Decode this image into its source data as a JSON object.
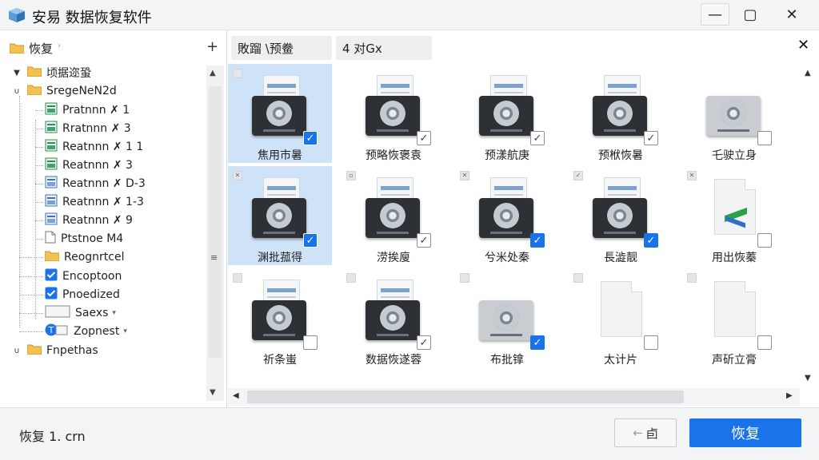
{
  "window": {
    "title": "安易  数据恢复软件",
    "controls": {
      "minimize": "—",
      "maximize": "▢",
      "close": "✕"
    }
  },
  "left_panel": {
    "header": {
      "label": "恢复",
      "chevron": "›",
      "add": "+"
    },
    "tree": [
      {
        "id": "root",
        "label": "顷据迩蛩",
        "twist": "▼",
        "icon": "folder-icon",
        "expanded": true
      },
      {
        "id": "storage",
        "label": "SregeNeN2d",
        "twist": "∪",
        "icon": "folder-icon",
        "expanded": true
      },
      {
        "id": "p1",
        "label": "Pratnnn ✗ 1",
        "icon": "partition-icon"
      },
      {
        "id": "p2",
        "label": "Rratnnn ✗ 3",
        "icon": "partition-icon"
      },
      {
        "id": "p3",
        "label": "Reatnnn ✗ 1 1",
        "icon": "partition-icon"
      },
      {
        "id": "p4",
        "label": "Reatnnn ✗ 3",
        "icon": "partition-icon"
      },
      {
        "id": "p5",
        "label": "Reatnnn ✗ D-3",
        "icon": "partition-icon"
      },
      {
        "id": "p6",
        "label": "Reatnnn ✗ 1-3",
        "icon": "partition-icon"
      },
      {
        "id": "p7",
        "label": "Reatnnn ✗ 9",
        "icon": "partition-icon"
      },
      {
        "id": "p8",
        "label": "Ptstnoe M4",
        "icon": "document-icon"
      },
      {
        "id": "recognized",
        "label": "Reognrtcel",
        "icon": "folder-icon"
      },
      {
        "id": "encrypted",
        "label": "Encoptoon",
        "icon": "checkbox-icon",
        "checked": true
      },
      {
        "id": "protected",
        "label": "Pnoedized",
        "icon": "checkbox-icon",
        "checked": true
      },
      {
        "id": "saved",
        "label": "Saexs",
        "icon": "file-icon",
        "dropdown": "▾"
      },
      {
        "id": "support",
        "label": "Zopnest",
        "icon": "info-icon",
        "dropdown": "▾"
      },
      {
        "id": "properties",
        "label": "Fnpethas",
        "twist": "∪",
        "icon": "folder-icon"
      }
    ],
    "scroll": {
      "up": "▲",
      "down": "▼",
      "grip": "≡"
    }
  },
  "tabs": [
    {
      "label": "敗蹓 \\预鲞"
    },
    {
      "label": "4 对Gx"
    }
  ],
  "tab_close": "✕",
  "grid": {
    "items": [
      {
        "label": "焦用市暑",
        "kind": "drive",
        "checked": true,
        "selected": true
      },
      {
        "label": "预略恢褒袁",
        "kind": "drive",
        "checked": true
      },
      {
        "label": "预漾航庚",
        "kind": "drive",
        "checked": true
      },
      {
        "label": "预栿恢暑",
        "kind": "drive",
        "checked": true
      },
      {
        "label": "乇驶立身",
        "kind": "drive-light",
        "checked": false
      },
      {
        "label": "渊批菰得",
        "kind": "drive",
        "checked": true,
        "selected": true
      },
      {
        "label": "涝挨廋",
        "kind": "drive",
        "checked": true
      },
      {
        "label": "兮米处秦",
        "kind": "drive",
        "checked": true
      },
      {
        "label": "長澁靓",
        "kind": "drive",
        "checked": true
      },
      {
        "label": "用出恢蓁",
        "kind": "file-logo",
        "checked": false
      },
      {
        "label": "祈条蚩",
        "kind": "drive",
        "checked": false
      },
      {
        "label": "数据恢遂蓉",
        "kind": "drive",
        "checked": true
      },
      {
        "label": "布批镎",
        "kind": "drive-light",
        "checked": true
      },
      {
        "label": "太计片",
        "kind": "file",
        "checked": false
      },
      {
        "label": "声斫立膏",
        "kind": "file",
        "checked": false
      },
      {
        "label": "",
        "kind": "partial"
      },
      {
        "label": "",
        "kind": "partial"
      },
      {
        "label": "",
        "kind": "partial"
      },
      {
        "label": "",
        "kind": "partial"
      },
      {
        "label": "",
        "kind": "partial"
      }
    ],
    "mini_marks": [
      "",
      "▫",
      "",
      "",
      "▫",
      "✕",
      "▫",
      "✕",
      "✓",
      "✕",
      "",
      "",
      "",
      "",
      ""
    ],
    "check_glyph": "✓",
    "vscroll": {
      "up": "▲",
      "down": "▼"
    },
    "hscroll": {
      "left": "◀",
      "right": "▶"
    }
  },
  "footer": {
    "status": "恢复 1. crn",
    "back_button": {
      "arrow": "←",
      "label": "卣"
    },
    "restore_button": "恢复"
  }
}
